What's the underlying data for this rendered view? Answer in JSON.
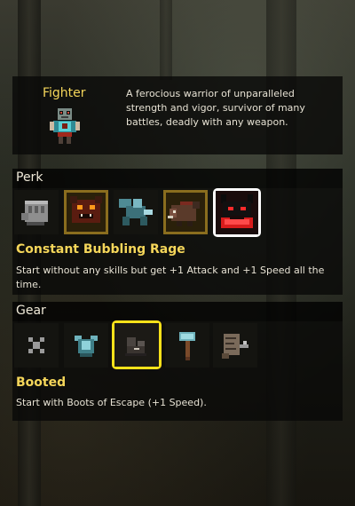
{
  "class_card": {
    "name": "Fighter",
    "description": "A ferocious warrior of unparalleled strength and vigor, survivor of many battles, deadly with any weapon.",
    "portrait_icon": "fighter-sprite-icon"
  },
  "perk_section": {
    "header": "Perk",
    "items": [
      {
        "icon": "stone-fist-icon",
        "selected": false
      },
      {
        "icon": "red-demon-icon",
        "selected": false
      },
      {
        "icon": "blue-beast-icon",
        "selected": false
      },
      {
        "icon": "boar-icon",
        "selected": false
      },
      {
        "icon": "rage-demon-icon",
        "selected": true
      }
    ],
    "selected_title": "Constant Bubbling Rage",
    "selected_description": "Start without any skills but get +1 Attack and +1 Speed all the time."
  },
  "gear_section": {
    "header": "Gear",
    "items": [
      {
        "icon": "none-x-icon",
        "selected": false
      },
      {
        "icon": "armor-icon",
        "selected": false
      },
      {
        "icon": "boots-icon",
        "selected": true
      },
      {
        "icon": "hammer-icon",
        "selected": false
      },
      {
        "icon": "scroll-icon",
        "selected": false
      }
    ],
    "selected_title": "Booted",
    "selected_description": "Start with Boots of Escape (+1 Speed)."
  },
  "colors": {
    "accent_title": "#f5d65a",
    "perk_selection_border": "#ffffff",
    "gear_selection_border": "#ffe21a"
  }
}
